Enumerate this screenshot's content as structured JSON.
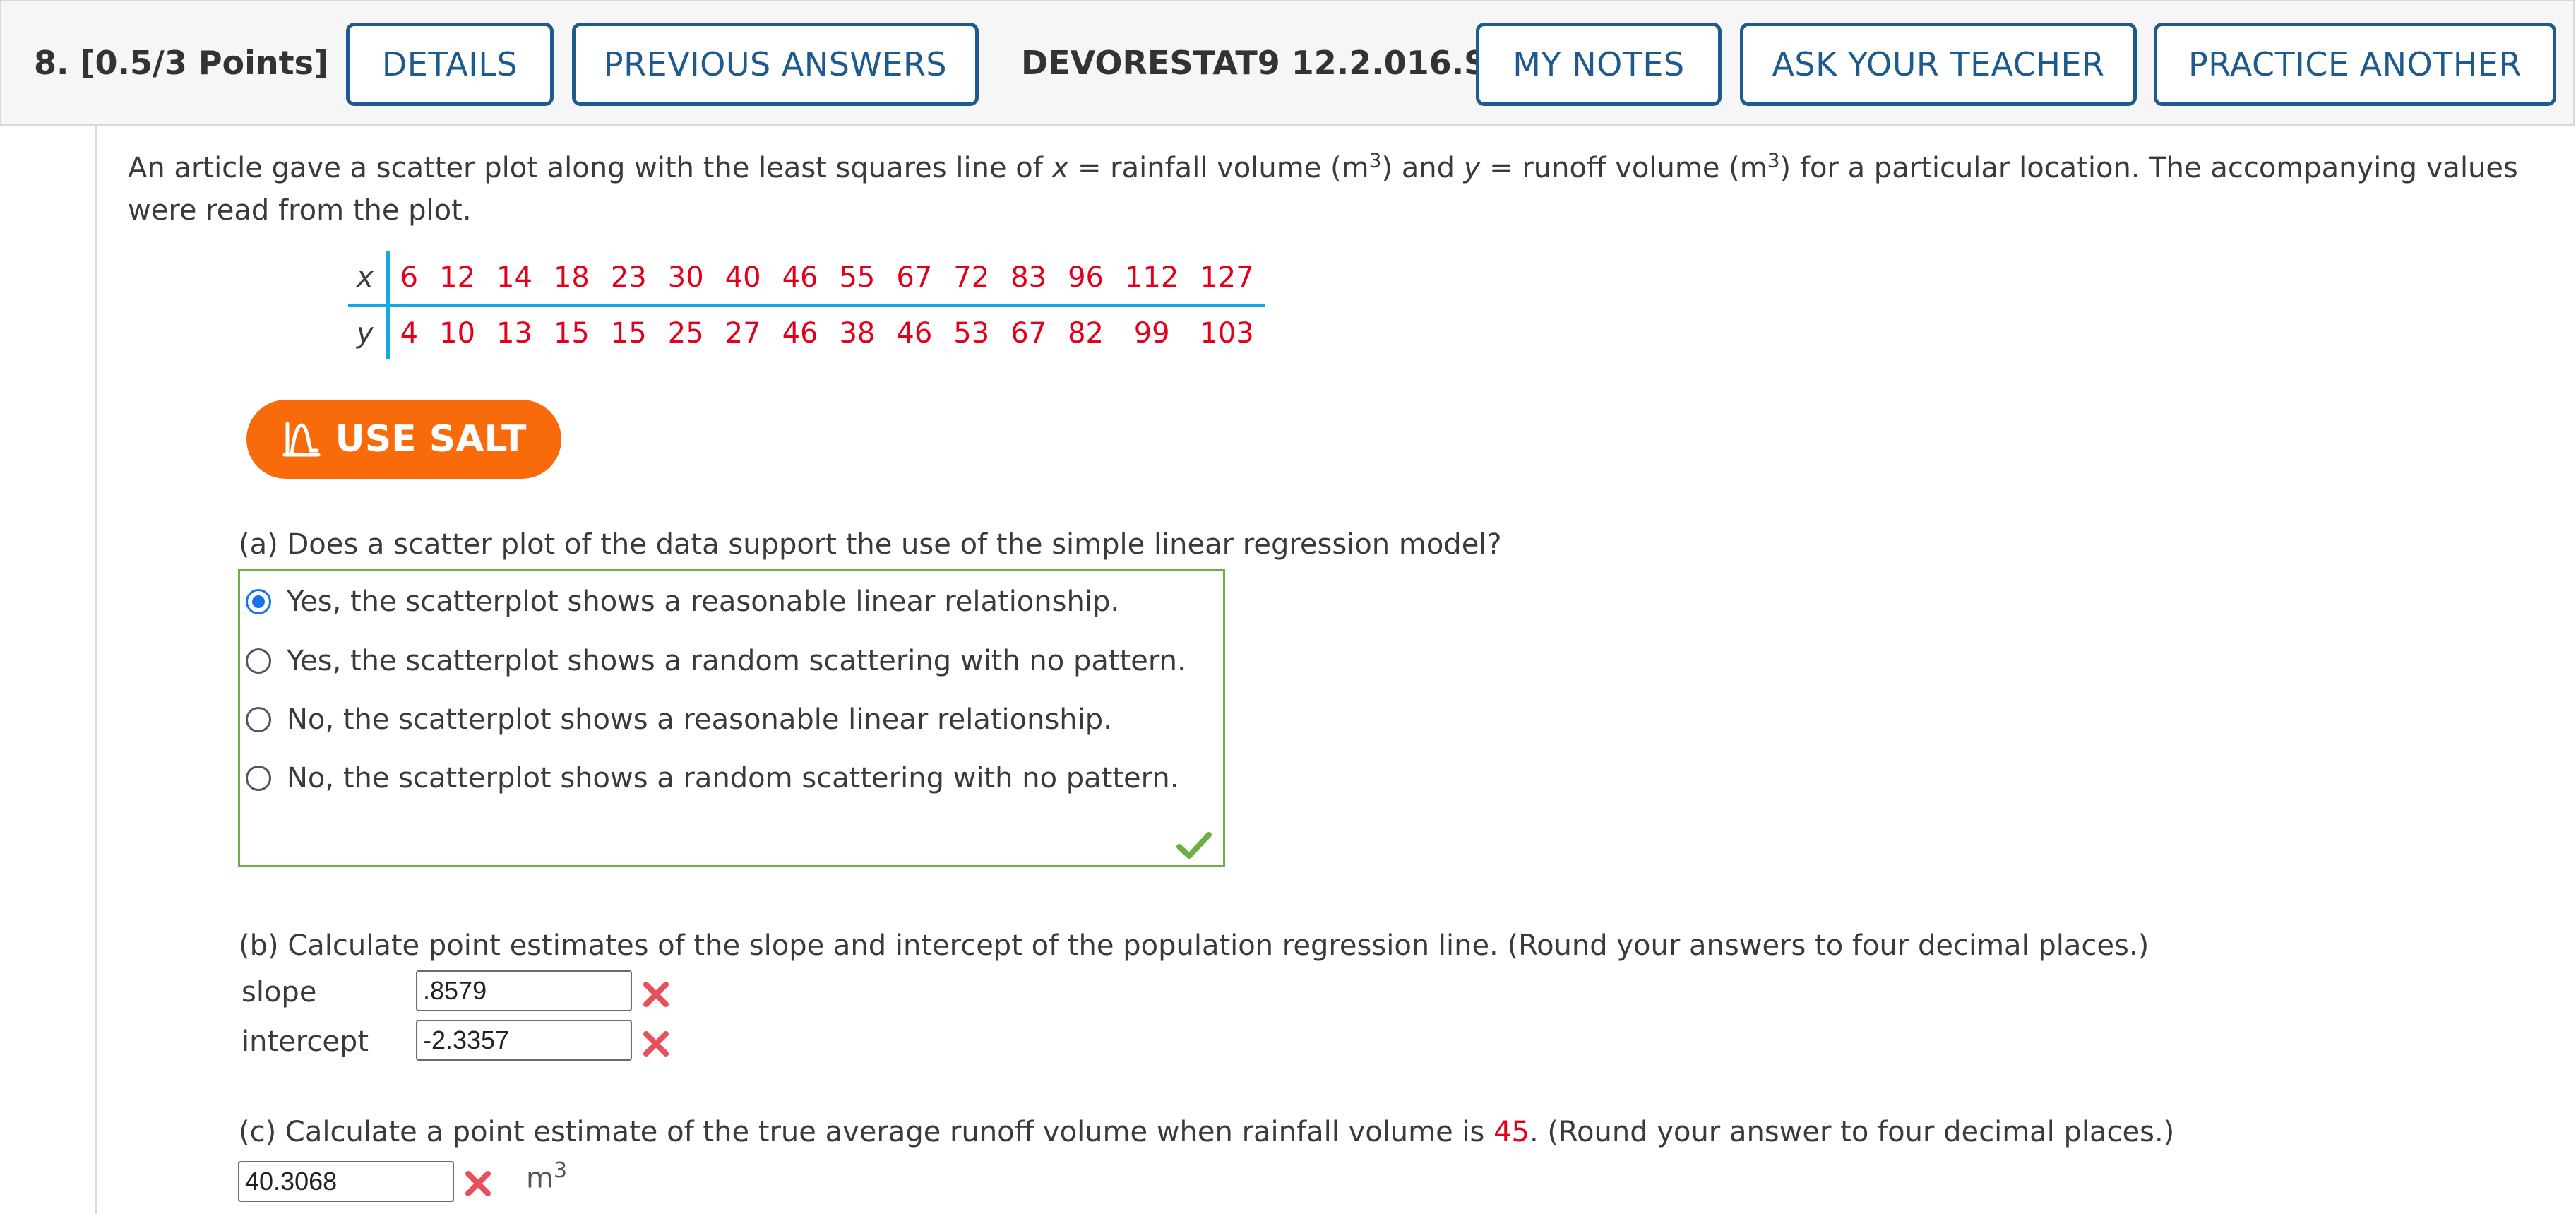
{
  "header": {
    "question_number": "8.",
    "points": "[0.5/3 Points]",
    "details_label": "DETAILS",
    "previous_answers_label": "PREVIOUS ANSWERS",
    "problem_code": "DEVORESTAT9 12.2.016.S.",
    "my_notes_label": "MY NOTES",
    "ask_teacher_label": "ASK YOUR TEACHER",
    "practice_another_label": "PRACTICE ANOTHER"
  },
  "intro": {
    "p1": "An article gave a scatter plot along with the least squares line of ",
    "x_var": "x",
    "p2": " = rainfall volume (m",
    "exp": "3",
    "p3": ") and ",
    "y_var": "y",
    "p4": " = runoff volume (m",
    "p5": ") for a particular location. The accompanying values were read from the plot."
  },
  "table": {
    "x_label": "x",
    "y_label": "y",
    "x_values": [
      "6",
      "12",
      "14",
      "18",
      "23",
      "30",
      "40",
      "46",
      "55",
      "67",
      "72",
      "83",
      "96",
      "112",
      "127"
    ],
    "y_values": [
      "4",
      "10",
      "13",
      "15",
      "15",
      "25",
      "27",
      "46",
      "38",
      "46",
      "53",
      "67",
      "82",
      "99",
      "103"
    ]
  },
  "salt": {
    "label": "USE SALT"
  },
  "part_a": {
    "question": "(a) Does a scatter plot of the data support the use of the simple linear regression model?",
    "options": [
      "Yes, the scatterplot shows a reasonable linear relationship.",
      "Yes, the scatterplot shows a random scattering with no pattern.",
      "No, the scatterplot shows a reasonable linear relationship.",
      "No, the scatterplot shows a random scattering with no pattern."
    ],
    "selected_index": 0
  },
  "part_b": {
    "question": "(b) Calculate point estimates of the slope and intercept of the population regression line. (Round your answers to four decimal places.)",
    "slope_label": "slope",
    "slope_value": ".8579",
    "intercept_label": "intercept",
    "intercept_value": "-2.3357"
  },
  "part_c": {
    "q1": "(c) Calculate a point estimate of the true average runoff volume when rainfall volume is ",
    "rainfall_value": "45",
    "q2": ". (Round your answer to four decimal places.)",
    "answer_value": "40.3068",
    "unit": "m",
    "unit_exp": "3"
  },
  "colors": {
    "accent_blue": "#1f5a8e",
    "value_red": "#e2001a",
    "table_rule": "#12a9e5",
    "salt_orange": "#f96a0b",
    "correct_green": "#6bb042",
    "wrong_red": "#e8505b"
  }
}
